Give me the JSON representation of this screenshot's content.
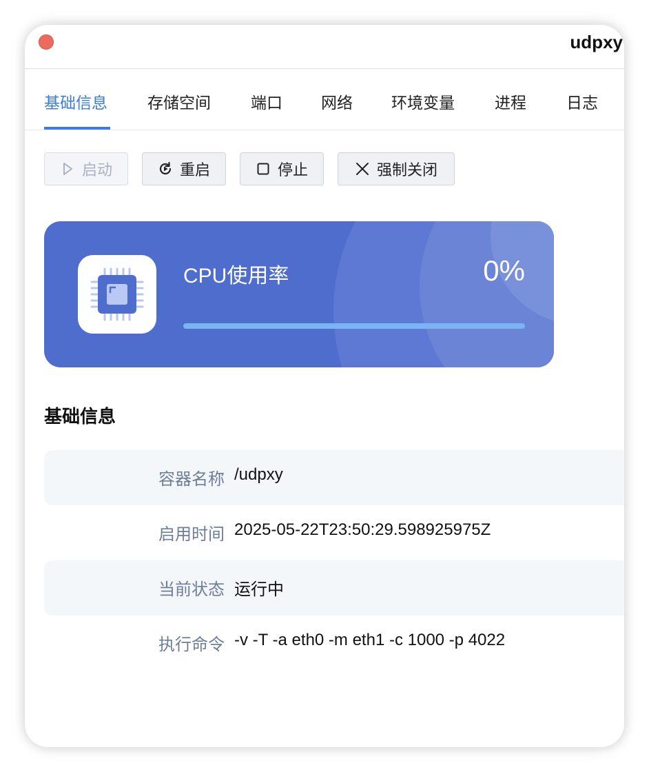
{
  "window": {
    "title": "udpxy"
  },
  "tabs": [
    {
      "label": "基础信息",
      "active": true
    },
    {
      "label": "存储空间"
    },
    {
      "label": "端口"
    },
    {
      "label": "网络"
    },
    {
      "label": "环境变量"
    },
    {
      "label": "进程"
    },
    {
      "label": "日志"
    }
  ],
  "toolbar": {
    "start": {
      "label": "启动",
      "icon": "play-icon",
      "disabled": true
    },
    "restart": {
      "label": "重启",
      "icon": "restart-icon"
    },
    "stop": {
      "label": "停止",
      "icon": "stop-icon"
    },
    "force_close": {
      "label": "强制关闭",
      "icon": "close-icon"
    }
  },
  "cpu": {
    "label": "CPU使用率",
    "value": "0%",
    "usage_fraction": 0,
    "icon": "cpu-chip-icon"
  },
  "basic_info": {
    "title": "基础信息",
    "rows": [
      {
        "key": "容器名称",
        "value": "/udpxy"
      },
      {
        "key": "启用时间",
        "value": "2025-05-22T23:50:29.598925975Z"
      },
      {
        "key": "当前状态",
        "value": "运行中"
      },
      {
        "key": "执行命令",
        "value": "-v -T -a eth0 -m eth1 -c 1000 -p 4022"
      }
    ]
  },
  "colors": {
    "accent": "#3a7be6",
    "card_bg": "#4f6dcc",
    "close_dot": "#ec6a5e",
    "row_shade": "#f4f7fa",
    "key_text": "#6e7d99"
  }
}
